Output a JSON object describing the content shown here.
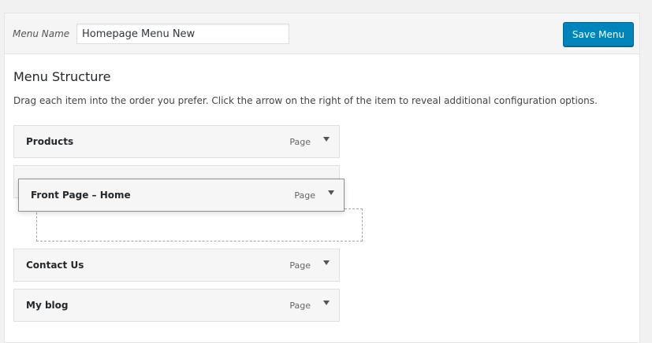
{
  "header": {
    "menu_name_label": "Menu Name",
    "menu_name_value": "Homepage Menu New",
    "save_label": "Save Menu"
  },
  "structure": {
    "title": "Menu Structure",
    "instructions": "Drag each item into the order you prefer. Click the arrow on the right of the item to reveal additional configuration options."
  },
  "items": [
    {
      "title": "Products",
      "type": "Page"
    },
    {
      "title": "Front Page – Home",
      "type": "Page"
    },
    {
      "title": "Contact Us",
      "type": "Page"
    },
    {
      "title": "My blog",
      "type": "Page"
    }
  ],
  "colors": {
    "primary_button": "#0085ba",
    "item_background": "#f6f6f6",
    "placeholder_border": "#a0a5aa"
  },
  "icons": {
    "expand_arrow": "triangle-down-icon"
  }
}
